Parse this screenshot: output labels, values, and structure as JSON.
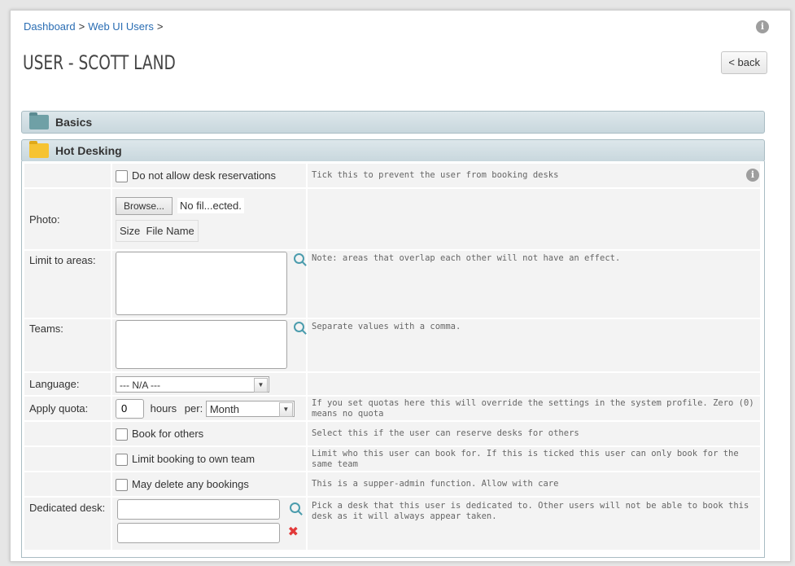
{
  "breadcrumb": {
    "dashboard": "Dashboard",
    "sep1": ">",
    "web_ui_users": "Web UI Users",
    "sep2": ">"
  },
  "page_title": "USER - SCOTT LAND",
  "back_label": "< back",
  "info_glyph": "i",
  "panels": {
    "basics": "Basics",
    "hot_desking": "Hot Desking"
  },
  "form": {
    "no_reservations": {
      "label": "Do not allow desk reservations",
      "hint": "Tick this to prevent the user from booking desks"
    },
    "photo": {
      "label": "Photo:",
      "browse": "Browse...",
      "file_status": "No fil...ected.",
      "col_size": "Size",
      "col_name": "File Name"
    },
    "areas": {
      "label": "Limit to areas:",
      "hint": "Note: areas that overlap each other will not have an effect."
    },
    "teams": {
      "label": "Teams:",
      "hint": "Separate values with a comma."
    },
    "language": {
      "label": "Language:",
      "value": "--- N/A ---"
    },
    "quota": {
      "label": "Apply quota:",
      "value": "0",
      "hours": "hours",
      "per": "per:",
      "period": "Month",
      "hint": "If you set quotas here this will override the settings in the system profile. Zero (0) means no quota"
    },
    "book_others": {
      "label": "Book for others",
      "hint": "Select this if the user can reserve desks for others"
    },
    "own_team": {
      "label": "Limit booking to own team",
      "hint": "Limit who this user can book for. If this is ticked this user can only book for the same team"
    },
    "delete_any": {
      "label": "May delete any bookings",
      "hint": "This is a supper-admin function.  Allow with care"
    },
    "dedicated": {
      "label": "Dedicated desk:",
      "hint": "Pick a desk that this user is dedicated to. Other users will not be able to book this desk as it will always appear taken.",
      "clear_glyph": "✖"
    }
  },
  "colors": {
    "link": "#2a6db3",
    "panel_bar": "#cfdde2",
    "folder_open": "#f6c332",
    "folder_closed": "#6fa0a6",
    "search": "#4b9cad",
    "clear": "#e23a3a"
  }
}
